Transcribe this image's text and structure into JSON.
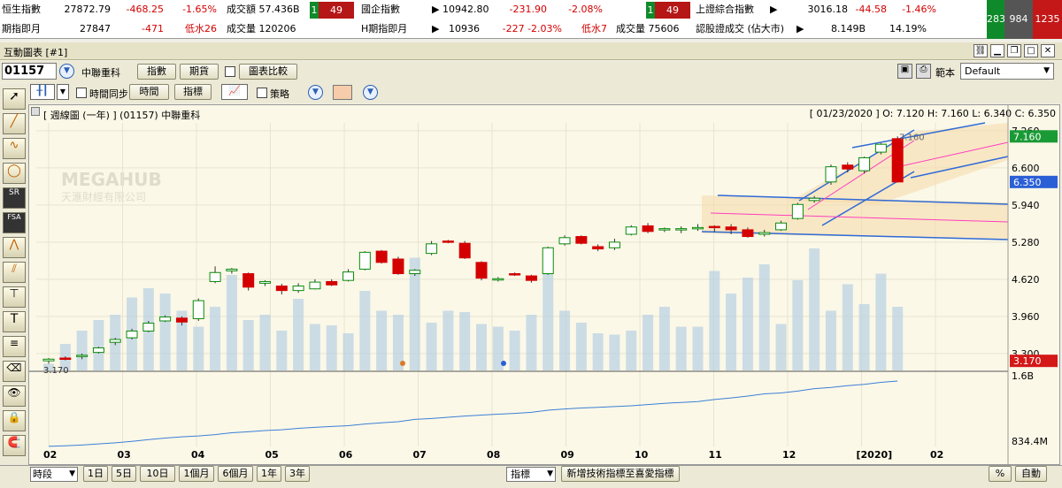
{
  "ticker": {
    "rows": [
      [
        {
          "label": "恒生指數",
          "value": "27872.79",
          "change": "-468.25",
          "pct": "-1.65%",
          "turnover_label": "成交額",
          "turnover": "57.436B",
          "adv": "1",
          "dec": "49"
        },
        {
          "label": "國企指數",
          "value": "10942.80",
          "change": "-231.90",
          "pct": "-2.08%",
          "adv": "1",
          "dec": "49"
        },
        {
          "label": "上證綜合指數",
          "value": "3016.18",
          "change": "-44.58",
          "pct": "-1.46%"
        }
      ],
      [
        {
          "label": "期指即月",
          "value": "27847",
          "change": "-471",
          "tag": "低水26",
          "vol_label": "成交量",
          "vol": "120206"
        },
        {
          "label": "H期指即月",
          "value": "10936",
          "change": "-227",
          "pct": "-2.03%",
          "tag": "低水7",
          "vol_label": "成交量",
          "vol": "75606"
        },
        {
          "label": "認股證成交 (佔大市)",
          "value": "8.149B",
          "pct": "14.19%"
        }
      ]
    ],
    "breadth": [
      "283",
      "984",
      "1235"
    ]
  },
  "window": {
    "title": "互動圖表 [#1]"
  },
  "toolbar1": {
    "code": "01157",
    "name": "中聯重科",
    "btn_index": "指數",
    "btn_futures": "期貨",
    "chk_compare": "圖表比較",
    "template_label": "範本",
    "template_value": "Default"
  },
  "toolbar2": {
    "chk_sync": "時間同步",
    "btn_time": "時間",
    "btn_indicator": "指標",
    "chk_strategy": "策略"
  },
  "chart": {
    "header_left": "[ 週線圖 (一年) ]  (01157)  中聯重科",
    "header_right": "[ 01/23/2020 ]  O: 7.120  H: 7.160  L: 6.340  C: 6.350",
    "watermark1": "MEGAHUB",
    "watermark2": "天滙財經有限公司",
    "last_price": "6.350",
    "high_label": "7.160",
    "low_label": "3.170",
    "vol_axis_top": "1.6B",
    "vol_axis_bottom": "834.4M",
    "colors": {
      "up": "#0a8a0a",
      "down": "#d40000",
      "volume": "#b8d0e3",
      "channel": "#2f6ad6",
      "fill": "#f6d9a8",
      "pink": "#ff3fbf",
      "line": "#3c7fd6"
    }
  },
  "chart_data": {
    "type": "candlestick",
    "y_ticks": [
      "7.260",
      "6.600",
      "5.940",
      "5.280",
      "4.620",
      "3.960",
      "3.300"
    ],
    "ylim": [
      3.0,
      7.4
    ],
    "x_ticks": [
      "02",
      "03",
      "04",
      "05",
      "06",
      "07",
      "08",
      "09",
      "10",
      "11",
      "12",
      "[2020]",
      "02"
    ],
    "candles": [
      {
        "o": 3.17,
        "h": 3.22,
        "l": 3.12,
        "c": 3.2
      },
      {
        "o": 3.22,
        "h": 3.25,
        "l": 3.18,
        "c": 3.2
      },
      {
        "o": 3.25,
        "h": 3.3,
        "l": 3.2,
        "c": 3.27
      },
      {
        "o": 3.32,
        "h": 3.42,
        "l": 3.3,
        "c": 3.4
      },
      {
        "o": 3.5,
        "h": 3.58,
        "l": 3.45,
        "c": 3.55
      },
      {
        "o": 3.58,
        "h": 3.74,
        "l": 3.55,
        "c": 3.7
      },
      {
        "o": 3.7,
        "h": 3.88,
        "l": 3.68,
        "c": 3.84
      },
      {
        "o": 3.88,
        "h": 3.98,
        "l": 3.86,
        "c": 3.95
      },
      {
        "o": 3.93,
        "h": 3.96,
        "l": 3.8,
        "c": 3.86
      },
      {
        "o": 3.92,
        "h": 4.28,
        "l": 3.88,
        "c": 4.24
      },
      {
        "o": 4.58,
        "h": 4.85,
        "l": 4.55,
        "c": 4.74
      },
      {
        "o": 4.77,
        "h": 4.82,
        "l": 4.72,
        "c": 4.8
      },
      {
        "o": 4.72,
        "h": 4.74,
        "l": 4.42,
        "c": 4.48
      },
      {
        "o": 4.55,
        "h": 4.6,
        "l": 4.5,
        "c": 4.58
      },
      {
        "o": 4.5,
        "h": 4.54,
        "l": 4.35,
        "c": 4.42
      },
      {
        "o": 4.42,
        "h": 4.55,
        "l": 4.38,
        "c": 4.5
      },
      {
        "o": 4.45,
        "h": 4.62,
        "l": 4.44,
        "c": 4.57
      },
      {
        "o": 4.58,
        "h": 4.62,
        "l": 4.5,
        "c": 4.52
      },
      {
        "o": 4.6,
        "h": 4.8,
        "l": 4.58,
        "c": 4.75
      },
      {
        "o": 4.8,
        "h": 5.12,
        "l": 4.78,
        "c": 5.1
      },
      {
        "o": 5.12,
        "h": 5.14,
        "l": 4.9,
        "c": 4.92
      },
      {
        "o": 4.98,
        "h": 5.02,
        "l": 4.7,
        "c": 4.72
      },
      {
        "o": 4.72,
        "h": 4.8,
        "l": 4.68,
        "c": 4.78
      },
      {
        "o": 5.08,
        "h": 5.3,
        "l": 5.05,
        "c": 5.25
      },
      {
        "o": 5.3,
        "h": 5.32,
        "l": 5.26,
        "c": 5.28
      },
      {
        "o": 5.26,
        "h": 5.3,
        "l": 4.98,
        "c": 5.0
      },
      {
        "o": 4.92,
        "h": 4.94,
        "l": 4.6,
        "c": 4.64
      },
      {
        "o": 4.62,
        "h": 4.66,
        "l": 4.58,
        "c": 4.63
      },
      {
        "o": 4.72,
        "h": 4.74,
        "l": 4.68,
        "c": 4.7
      },
      {
        "o": 4.68,
        "h": 4.7,
        "l": 4.56,
        "c": 4.6
      },
      {
        "o": 4.72,
        "h": 5.2,
        "l": 4.7,
        "c": 5.18
      },
      {
        "o": 5.25,
        "h": 5.4,
        "l": 5.22,
        "c": 5.36
      },
      {
        "o": 5.38,
        "h": 5.4,
        "l": 5.24,
        "c": 5.26
      },
      {
        "o": 5.2,
        "h": 5.24,
        "l": 5.12,
        "c": 5.16
      },
      {
        "o": 5.18,
        "h": 5.34,
        "l": 5.14,
        "c": 5.28
      },
      {
        "o": 5.42,
        "h": 5.58,
        "l": 5.4,
        "c": 5.55
      },
      {
        "o": 5.57,
        "h": 5.62,
        "l": 5.44,
        "c": 5.47
      },
      {
        "o": 5.52,
        "h": 5.54,
        "l": 5.46,
        "c": 5.52
      },
      {
        "o": 5.52,
        "h": 5.56,
        "l": 5.44,
        "c": 5.52
      },
      {
        "o": 5.52,
        "h": 5.6,
        "l": 5.48,
        "c": 5.54
      },
      {
        "o": 5.56,
        "h": 5.58,
        "l": 5.46,
        "c": 5.54
      },
      {
        "o": 5.55,
        "h": 5.6,
        "l": 5.42,
        "c": 5.5
      },
      {
        "o": 5.5,
        "h": 5.54,
        "l": 5.36,
        "c": 5.38
      },
      {
        "o": 5.42,
        "h": 5.5,
        "l": 5.38,
        "c": 5.45
      },
      {
        "o": 5.5,
        "h": 5.66,
        "l": 5.48,
        "c": 5.62
      },
      {
        "o": 5.7,
        "h": 5.98,
        "l": 5.68,
        "c": 5.95
      },
      {
        "o": 6.02,
        "h": 6.1,
        "l": 5.98,
        "c": 6.06
      },
      {
        "o": 6.35,
        "h": 6.66,
        "l": 6.3,
        "c": 6.62
      },
      {
        "o": 6.65,
        "h": 6.7,
        "l": 6.52,
        "c": 6.58
      },
      {
        "o": 6.55,
        "h": 6.8,
        "l": 6.5,
        "c": 6.78
      },
      {
        "o": 6.88,
        "h": 7.04,
        "l": 6.84,
        "c": 7.02
      },
      {
        "o": 7.12,
        "h": 7.16,
        "l": 6.34,
        "c": 6.35
      }
    ],
    "volumes": [
      0.05,
      0.2,
      0.3,
      0.38,
      0.42,
      0.55,
      0.62,
      0.58,
      0.45,
      0.33,
      0.48,
      0.72,
      0.38,
      0.42,
      0.3,
      0.54,
      0.35,
      0.34,
      0.28,
      0.6,
      0.45,
      0.42,
      0.85,
      0.36,
      0.45,
      0.44,
      0.35,
      0.33,
      0.3,
      0.42,
      0.75,
      0.45,
      0.36,
      0.28,
      0.27,
      0.3,
      0.42,
      0.48,
      0.33,
      0.33,
      0.75,
      0.58,
      0.7,
      0.8,
      0.35,
      0.68,
      0.92,
      0.45,
      0.65,
      0.5,
      0.73,
      0.48
    ]
  },
  "bottom": {
    "period_label": "時段",
    "periods": [
      "1日",
      "5日",
      "10日",
      "1個月",
      "6個月",
      "1年",
      "3年"
    ],
    "indicator_label": "指標",
    "add_indicator": "新增技術指標至喜愛指標",
    "pct_btn": "%",
    "auto_btn": "自動"
  }
}
